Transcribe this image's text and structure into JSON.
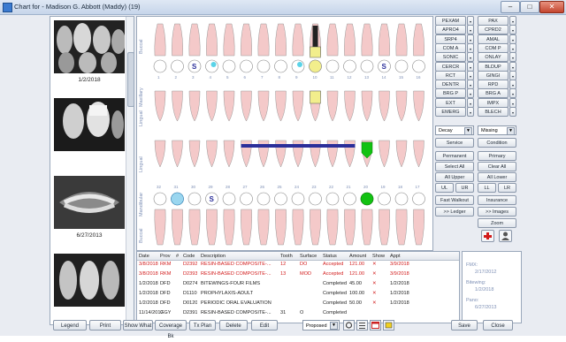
{
  "window": {
    "title": "Chart for - Madison G. Abbott (Maddy) (19)",
    "minimize": "–",
    "maximize": "□",
    "close": "✕"
  },
  "thumbnails": [
    {
      "date": "1/2/2018"
    },
    {
      "date": ""
    },
    {
      "date": "6/27/2013"
    },
    {
      "date": ""
    }
  ],
  "chart": {
    "labels": {
      "buccal_top": "Buccal",
      "maxillary": "Maxillary",
      "lingual_top": "Lingual",
      "lingual_bottom": "Lingual",
      "mandibular": "Mandibular",
      "buccal_bottom": "Buccal"
    },
    "upper_numbers": [
      "1",
      "2",
      "3",
      "4",
      "5",
      "6",
      "7",
      "8",
      "9",
      "10",
      "11",
      "12",
      "13",
      "14",
      "15",
      "16"
    ],
    "lower_numbers": [
      "32",
      "31",
      "30",
      "29",
      "28",
      "27",
      "26",
      "25",
      "24",
      "23",
      "22",
      "21",
      "20",
      "19",
      "18",
      "17"
    ]
  },
  "right_panel": {
    "left_col": [
      "PEXAM",
      "APRO4",
      "SRP4",
      "COM A",
      "SONIC",
      "CERCR",
      "RCT",
      "DENTR",
      "BRG P",
      "EXT",
      "EMERG"
    ],
    "right_col": [
      "PAX",
      "CPRD2",
      "AMAL",
      "COM P",
      "ONLAY",
      "BLDUP",
      "GINGI",
      "RPD",
      "BRG A",
      "IMPX",
      "BLECH"
    ],
    "dropdowns": {
      "decay": "Decay",
      "missing": "Missing"
    },
    "buttons": {
      "service": "Service",
      "condition": "Condition",
      "permanent": "Permanent",
      "primary": "Primary",
      "select_all": "Select All",
      "clear_all": "Clear All",
      "all_upper": "All Upper",
      "all_lower": "All Lower",
      "ul": "UL",
      "ur": "UR",
      "ll": "LL",
      "lr": "LR",
      "fast_walkout": "Fast Walkout",
      "insurance": "Insurance",
      "to_ledger": ">> Ledger",
      "to_images": ">> Images",
      "zoom": "Zoom"
    }
  },
  "table": {
    "headers": [
      "Date",
      "Prov",
      "#",
      "Code",
      "Description",
      "Tooth",
      "Surface",
      "Status",
      "Amount",
      "Show",
      "Appt"
    ],
    "rows": [
      {
        "date": "3/8/2018",
        "prov": "RKM",
        "num": "",
        "code": "D2392",
        "desc": "RESIN-BASED COMPOSITE-...",
        "tooth": "12",
        "surface": "DO",
        "status": "Accepted",
        "amount": "121.00",
        "show": "✕",
        "appt": "3/9/2018",
        "color": "red"
      },
      {
        "date": "3/8/2018",
        "prov": "RKM",
        "num": "",
        "code": "D2393",
        "desc": "RESIN-BASED COMPOSITE-...",
        "tooth": "13",
        "surface": "MOD",
        "status": "Accepted",
        "amount": "121.00",
        "show": "✕",
        "appt": "3/9/2018",
        "color": "red"
      },
      {
        "date": "1/2/2018",
        "prov": "DFD",
        "num": "",
        "code": "D0274",
        "desc": "BITEWINGS-FOUR FILMS",
        "tooth": "",
        "surface": "",
        "status": "Completed",
        "amount": "45.00",
        "show": "✕",
        "appt": "1/2/2018",
        "color": "blk"
      },
      {
        "date": "1/2/2018",
        "prov": "DFD",
        "num": "",
        "code": "D1110",
        "desc": "PROPHYLAXIS-ADULT",
        "tooth": "",
        "surface": "",
        "status": "Completed",
        "amount": "100.00",
        "show": "✕",
        "appt": "1/2/2018",
        "color": "blk"
      },
      {
        "date": "1/2/2018",
        "prov": "DFD",
        "num": "",
        "code": "D0120",
        "desc": "PERIODIC ORAL EVALUATION",
        "tooth": "",
        "surface": "",
        "status": "Completed",
        "amount": "50.00",
        "show": "✕",
        "appt": "1/2/2018",
        "color": "blk"
      },
      {
        "date": "11/14/2017",
        "prov": "GGY",
        "num": "",
        "code": "D2391",
        "desc": "RESIN-BASED COMPOSITE-...",
        "tooth": "31",
        "surface": "O",
        "status": "Completed",
        "amount": "",
        "show": "",
        "appt": "",
        "color": "blk"
      }
    ]
  },
  "info_panel": {
    "fmx_label": "FMX:",
    "fmx_date": "2/17/2012",
    "bitewing_label": "Bitewing:",
    "bitewing_date": "1/2/2018",
    "pano_label": "Pano:",
    "pano_date": "6/27/2013"
  },
  "bottom_bar": {
    "legend": "Legend",
    "print": "Print",
    "show_what": "Show What",
    "coverage": "Coverage Bk",
    "tx_plan": "Tx Plan",
    "delete": "Delete",
    "edit": "Edit",
    "status_dropdown": "Proposed",
    "save": "Save",
    "close": "Close"
  },
  "colors": {
    "accepted": "#d21b1b",
    "tooth_pink": "#f4c9c9",
    "filling_blue": "#2b2f9a",
    "implant_green": "#12c212",
    "crown_yellow": "#f2ee8c"
  }
}
